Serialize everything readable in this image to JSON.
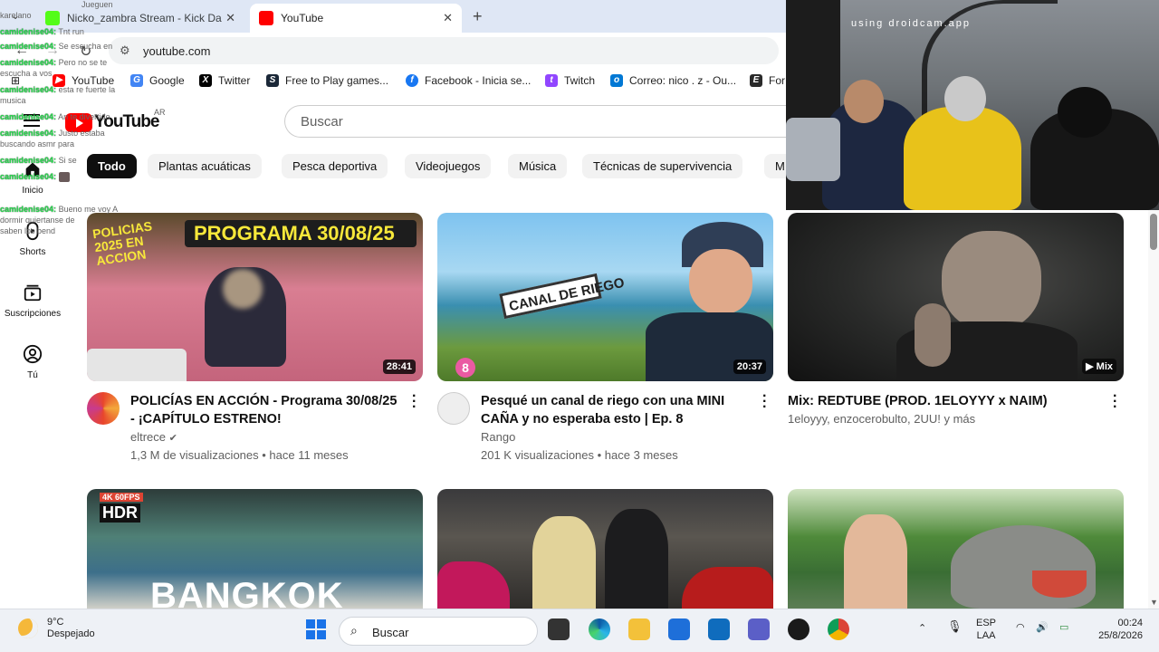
{
  "browser": {
    "tabs": [
      {
        "label": "Nicko_zambra Stream - Kick Da",
        "active": false
      },
      {
        "label": "YouTube",
        "active": true
      }
    ],
    "url": "youtube.com",
    "bookmarks": [
      "YouTube",
      "Google",
      "Twitter",
      "Free to Play games...",
      "Facebook - Inicia se...",
      "Twitch",
      "Correo: nico . z - Ou...",
      "For"
    ]
  },
  "youtube": {
    "logo_text": "YouTube",
    "country": "AR",
    "search_placeholder": "Buscar",
    "chips": [
      "Todo",
      "Plantas acuáticas",
      "Pesca deportiva",
      "Videojuegos",
      "Música",
      "Técnicas de supervivencia",
      "M"
    ],
    "nav": [
      {
        "label": "Inicio",
        "icon": "home-icon"
      },
      {
        "label": "Shorts",
        "icon": "shorts-icon"
      },
      {
        "label": "Suscripciones",
        "icon": "subscriptions-icon"
      },
      {
        "label": "Tú",
        "icon": "you-icon"
      }
    ],
    "videos": [
      {
        "title": "POLICÍAS EN ACCIÓN - Programa 30/08/25 - ¡CAPÍTULO ESTRENO!",
        "channel": "eltrece",
        "stats": "1,3 M de visualizaciones • hace 11 meses",
        "duration": "28:41",
        "thumb_text": "PROGRAMA 30/08/25",
        "thumb_text2": "POLICIAS 2025 EN ACCION"
      },
      {
        "title": "Pesqué un canal de riego con una MINI CAÑA y no esperaba esto | Ep. 8",
        "channel": "Rango",
        "stats": "201 K visualizaciones • hace 3 meses",
        "duration": "20:37",
        "thumb_text": "CANAL DE RIEGO",
        "thumb_text2": "8"
      },
      {
        "title": "Mix: REDTUBE (PROD. 1ELOYYY x NAIM)",
        "channel": "1eloyyy, enzocerobulto, 2UU! y más",
        "stats": "",
        "duration": "Mix",
        "thumb_text": "",
        "thumb_text2": ""
      },
      {
        "title": "",
        "channel": "",
        "stats": "",
        "duration": "",
        "thumb_text": "BANGKOK",
        "thumb_text2": "HDR"
      },
      {
        "title": "",
        "channel": "",
        "stats": "",
        "duration": "",
        "thumb_text": "",
        "thumb_text2": ""
      },
      {
        "title": "",
        "channel": "",
        "stats": "",
        "duration": "",
        "thumb_text": "",
        "thumb_text2": ""
      }
    ]
  },
  "webcam": {
    "caption": "using droidcam.app"
  },
  "chat": [
    {
      "user": "",
      "msg": "Jueguen"
    },
    {
      "user": "",
      "msg": "karelano"
    },
    {
      "user": "camidenise04:",
      "msg": "Tnt run"
    },
    {
      "user": "camidenise04:",
      "msg": "Se escucha en"
    },
    {
      "user": "camidenise04:",
      "msg": "Pero no se te"
    },
    {
      "user": "",
      "msg": "escucha a vos"
    },
    {
      "user": "camidenise04:",
      "msg": "esta re fuerte la"
    },
    {
      "user": "",
      "msg": "musica"
    },
    {
      "user": "camidenise04:",
      "msg": "An te divertido"
    },
    {
      "user": "camidenise04:",
      "msg": "Justo estaba"
    },
    {
      "user": "",
      "msg": "buscando asmr para"
    },
    {
      "user": "camidenise04:",
      "msg": "Si se"
    },
    {
      "user": "camidenise04:",
      "msg": ""
    },
    {
      "user": "camidenise04:",
      "msg": "Bueno me voy A"
    },
    {
      "user": "",
      "msg": "dormir quiertanse de"
    },
    {
      "user": "",
      "msg": "saben los bend"
    }
  ],
  "taskbar": {
    "weather_temp": "9°C",
    "weather_desc": "Despejado",
    "search_placeholder": "Buscar",
    "lang1": "ESP",
    "lang2": "LAA",
    "time": "00:24",
    "date": "25/8/2026"
  },
  "colors": {
    "accent_red": "#ff0000",
    "chat_green": "#26e04e"
  }
}
